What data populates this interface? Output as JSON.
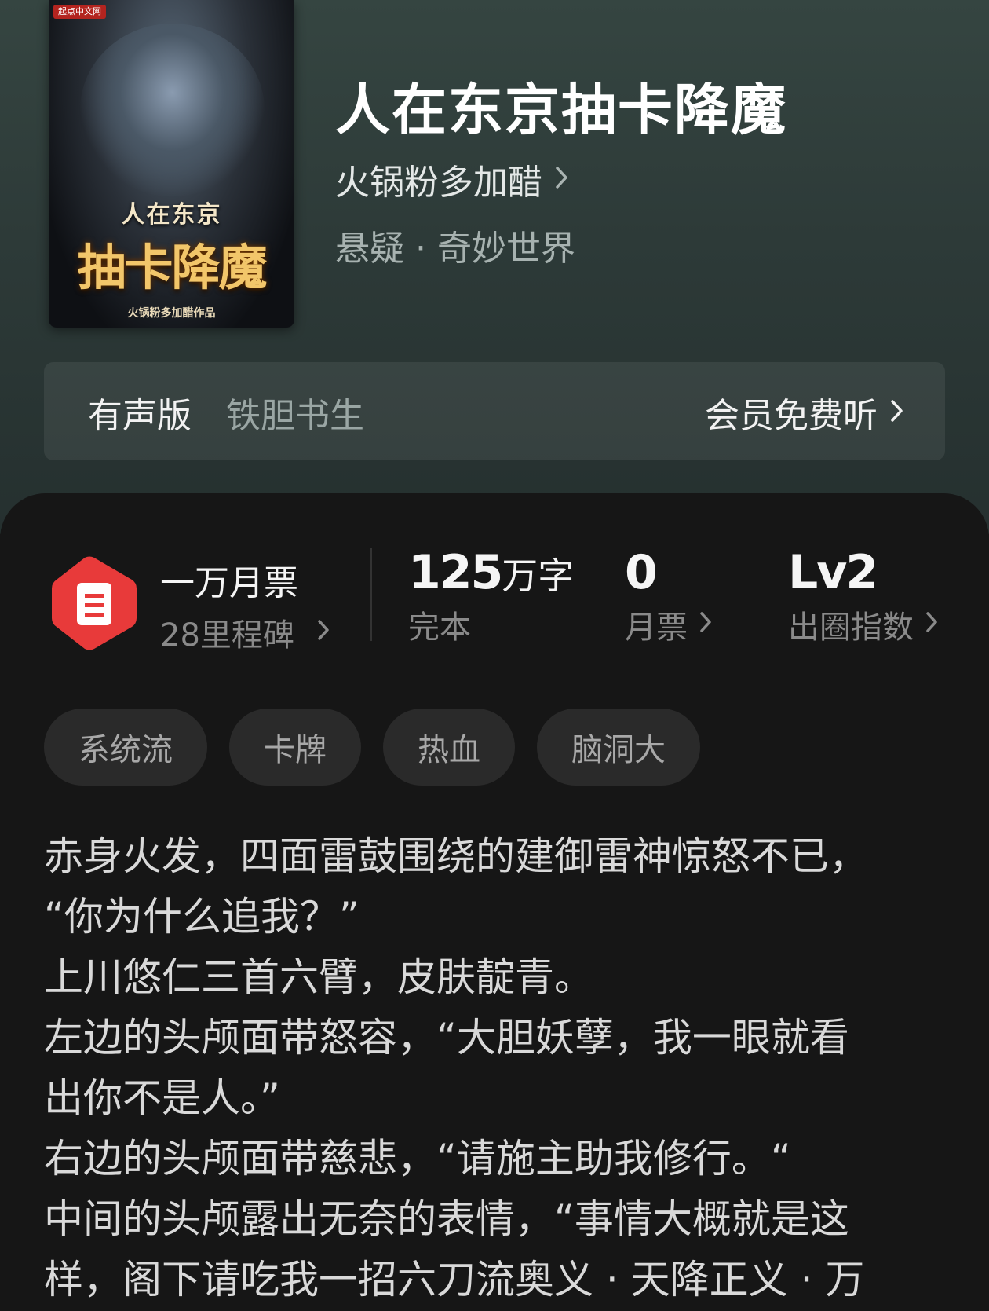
{
  "cover": {
    "badge": "起点中文网",
    "title_top": "人在东京",
    "title_main": "抽卡降魔",
    "author_line": "火锅粉多加醋作品"
  },
  "book": {
    "title": "人在东京抽卡降魔",
    "author": "火锅粉多加醋",
    "genre": "悬疑 · 奇妙世界"
  },
  "audio": {
    "label": "有声版",
    "narrator": "铁胆书生",
    "cta": "会员免费听"
  },
  "stats": {
    "monthly_badge": {
      "title": "一万月票",
      "subtitle": "28里程碑",
      "icon": "ticket-icon",
      "color": "#e83a3a"
    },
    "words": {
      "value": "125",
      "unit": "万字",
      "label": "完本"
    },
    "monthly_votes": {
      "value": "0",
      "label": "月票"
    },
    "influence": {
      "value": "Lv2",
      "label": "出圈指数"
    }
  },
  "tags": [
    "系统流",
    "卡牌",
    "热血",
    "脑洞大"
  ],
  "synopsis": [
    "赤身火发，四面雷鼓围绕的建御雷神惊怒不已，",
    "“你为什么追我？”",
    "上川悠仁三首六臂，皮肤靛青。",
    "左边的头颅面带怒容，“大胆妖孽，我一眼就看",
    "出你不是人。”",
    "右边的头颅面带慈悲，“请施主助我修行。“",
    "中间的头颅露出无奈的表情，“事情大概就是这",
    "样，阁下请吃我一招六刀流奥义 · 天降正义 · 万"
  ]
}
